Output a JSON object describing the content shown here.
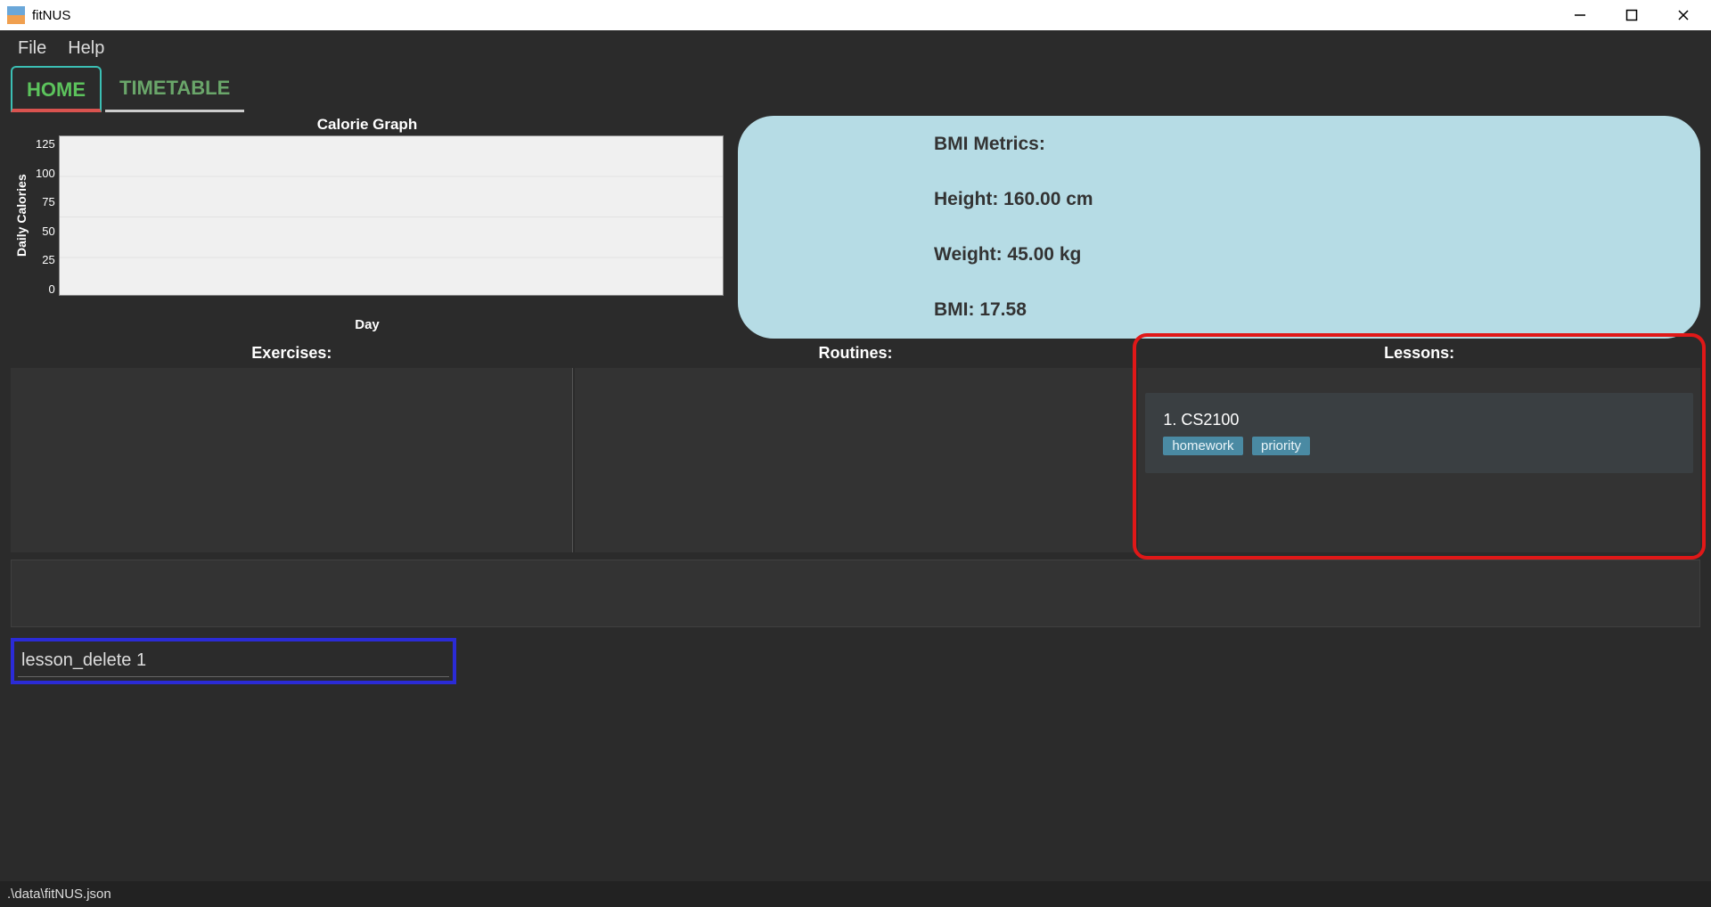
{
  "window": {
    "title": "fitNUS"
  },
  "menu": {
    "file": "File",
    "help": "Help"
  },
  "tabs": {
    "home": "HOME",
    "timetable": "TIMETABLE"
  },
  "chart_data": {
    "type": "bar",
    "title": "Calorie Graph",
    "xlabel": "Day",
    "ylabel": "Daily Calories",
    "categories": [],
    "values": [],
    "ylim": [
      0,
      125
    ],
    "yticks": [
      "125",
      "100",
      "75",
      "50",
      "25",
      "0"
    ]
  },
  "bmi": {
    "header": "BMI Metrics:",
    "height_line": "Height: 160.00 cm",
    "weight_line": "Weight: 45.00 kg",
    "bmi_line": "BMI: 17.58"
  },
  "lists": {
    "exercises_header": "Exercises:",
    "routines_header": "Routines:",
    "lessons_header": "Lessons:",
    "lessons": [
      {
        "index_name": "1.   CS2100",
        "tags": [
          "homework",
          "priority"
        ]
      }
    ]
  },
  "command": {
    "value": "lesson_delete 1"
  },
  "status": {
    "path": ".\\data\\fitNUS.json"
  }
}
